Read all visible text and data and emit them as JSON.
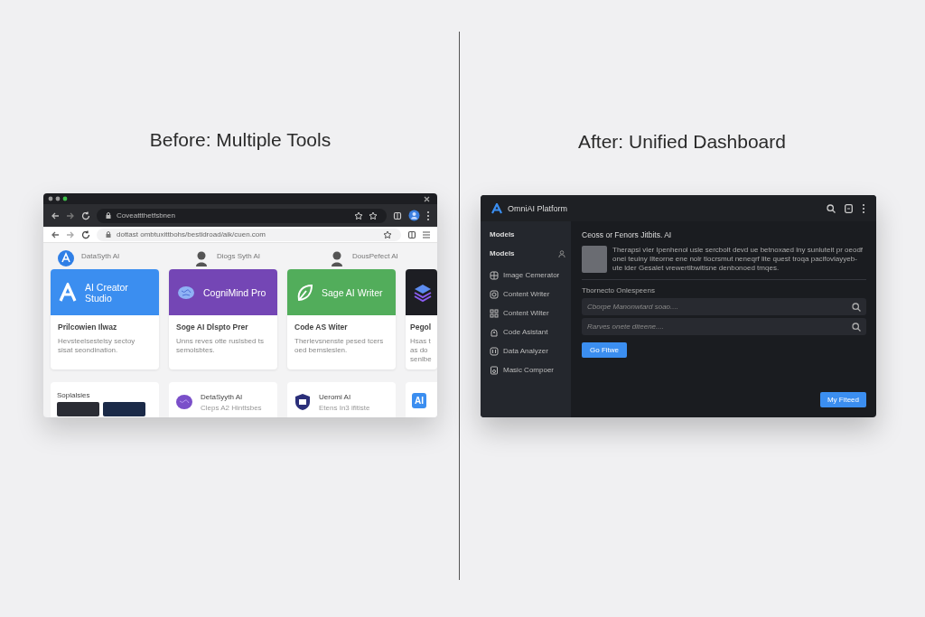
{
  "before": {
    "heading": "Before: Multiple Tools",
    "browser": {
      "top_url": "Coveattthetfsbnen",
      "address_url": "dottast ombtuxittbohs/bestidroad/aik/cuen.com",
      "background_tools": [
        {
          "name": "DataSyth AI"
        },
        {
          "name": "Diogs Syth AI"
        },
        {
          "name": "DousPefect AI"
        }
      ],
      "tool_cards": [
        {
          "title": "AI Creator Studio",
          "subtitle": "Prilcowien Ilwaz",
          "description": "Hevsteelsestelsy sectoy sisat seondination.",
          "color": "#3b8ef0"
        },
        {
          "title": "CogniMind Pro",
          "subtitle": "Soge AI Dlspto Prer",
          "description": "Unns reves otte ruslsbed ts semolsbtes.",
          "color": "#7446b5"
        },
        {
          "title": "Sage AI Writer",
          "subtitle": "Code AS Witer",
          "description": "Therlevsnenste pesed tcers oed bemsleslen.",
          "color": "#52ad5b"
        },
        {
          "subtitle": "Pegol",
          "description": "Hsas t as do senlbe",
          "color": "#1d1e23"
        }
      ],
      "lower_cards": [
        {
          "kind": "gallery",
          "title": "Soplalsies"
        },
        {
          "kind": "app",
          "title": "DetaSyyth AI",
          "subtitle": "Cleps A2 Hinttsbes"
        },
        {
          "kind": "app",
          "title": "Ueromi AI",
          "subtitle": "Etens In3 ifitiste"
        },
        {
          "kind": "badge",
          "badge": "AI"
        }
      ]
    }
  },
  "after": {
    "heading": "After: Unified Dashboard",
    "dashboard": {
      "title": "OmniAI Platform",
      "sidebar": [
        {
          "kind": "heading",
          "label": "Models"
        },
        {
          "kind": "section",
          "label": "Models"
        },
        {
          "kind": "item",
          "label": "Image Cemerator"
        },
        {
          "kind": "item",
          "label": "Content Writer"
        },
        {
          "kind": "item",
          "label": "Content Wilter"
        },
        {
          "kind": "item",
          "label": "Code Asistant"
        },
        {
          "kind": "item",
          "label": "Data Analyzer"
        },
        {
          "kind": "item",
          "label": "Masic Compoer"
        }
      ],
      "main": {
        "title": "Ceoss or Fenors Jitbits. AI",
        "description": "Therapsi vler Ipenhenol usle sercbolt devd ue betnoxaed lny sunluteit pr oeodf onei teuiny Ilteorne ene nolr tiocrsmut neneqrf lite quest troqa pacifoviayyeb-ute lder Gesalet vrewertlbwitisne denbonoed tmqes.",
        "section_label": "Tbornecto Onlespeens",
        "fields": [
          {
            "placeholder": "Cborpe Manonwtard soao...."
          },
          {
            "placeholder": "Rarves onete diteene...."
          }
        ],
        "primary_button": "Go Fitwe",
        "footer_button": "My Fiteed"
      }
    }
  }
}
